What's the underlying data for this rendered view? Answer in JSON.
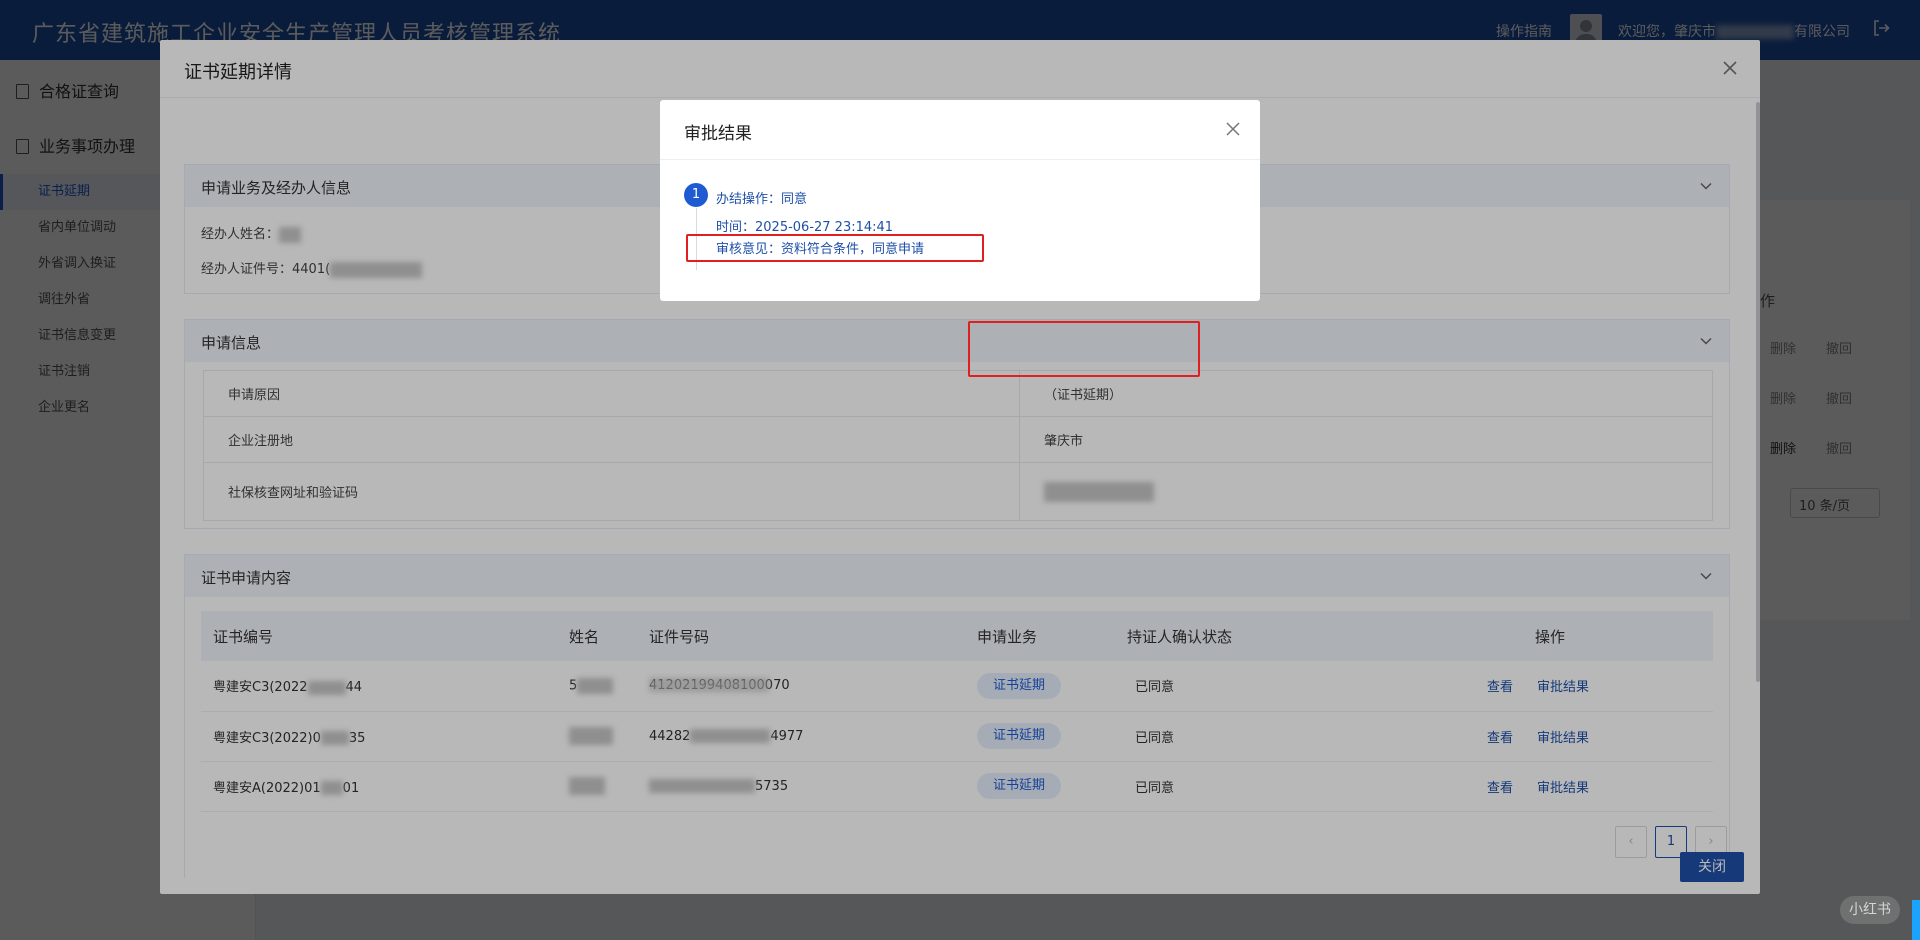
{
  "app": {
    "title": "广东省建筑施工企业安全生产管理人员考核管理系统",
    "help": "操作指南",
    "welcome": "欢迎您，肇庆市",
    "welcome_suffix": "有限公司"
  },
  "sidebar": {
    "groups": [
      {
        "label": "合格证查询"
      },
      {
        "label": "业务事项办理"
      }
    ],
    "items": [
      {
        "label": "证书延期"
      },
      {
        "label": "省内单位调动"
      },
      {
        "label": "外省调入换证"
      },
      {
        "label": "调往外省"
      },
      {
        "label": "证书信息变更"
      },
      {
        "label": "证书注销"
      },
      {
        "label": "企业更名"
      }
    ]
  },
  "background": {
    "delete": "删除",
    "revoke": "撤回",
    "page_size": "10 条/页",
    "header_fragment": "作"
  },
  "modal": {
    "title": "证书延期详情",
    "close_label": "关闭",
    "applicant": {
      "section_title": "申请业务及经办人信息",
      "name_label": "经办人姓名：",
      "id_label": "经办人证件号：",
      "id_value": "4401("
    },
    "apply_info": {
      "section_title": "申请信息",
      "rows": [
        {
          "label": "申请原因",
          "value": "（证书延期）"
        },
        {
          "label": "企业注册地",
          "value": "肇庆市"
        },
        {
          "label": "社保核查网址和验证码",
          "value": ""
        }
      ]
    },
    "cert_content": {
      "section_title": "证书申请内容",
      "headers": [
        "证书编号",
        "姓名",
        "证件号码",
        "申请业务",
        "持证人确认状态",
        "操作"
      ],
      "rows": [
        {
          "cert_no": "粤建安C3(2022",
          "cert_no_tail": "44",
          "name": "5",
          "id_no": "",
          "id_tail": "41202199408100070",
          "business": "证书延期",
          "status": "已同意",
          "view": "查看",
          "result": "审批结果"
        },
        {
          "cert_no": "粤建安C3(2022)0",
          "cert_no_tail": "35",
          "name": "",
          "id_no": "44282",
          "id_tail": "4977",
          "business": "证书延期",
          "status": "已同意",
          "view": "查看",
          "result": "审批结果"
        },
        {
          "cert_no": "粤建安A(2022)01",
          "cert_no_tail": "01",
          "name": "",
          "id_no": "",
          "id_tail": "5735",
          "business": "证书延期",
          "status": "已同意",
          "view": "查看",
          "result": "审批结果"
        }
      ],
      "pagination": {
        "prev": "‹",
        "current": "1",
        "next": "›"
      }
    }
  },
  "approval": {
    "title": "审批结果",
    "step_number": "1",
    "action": "办结操作：同意",
    "time": "时间：2025-06-27 23:14:41",
    "opinion": "审核意见：资料符合条件，同意申请"
  },
  "watermark": "小红书"
}
